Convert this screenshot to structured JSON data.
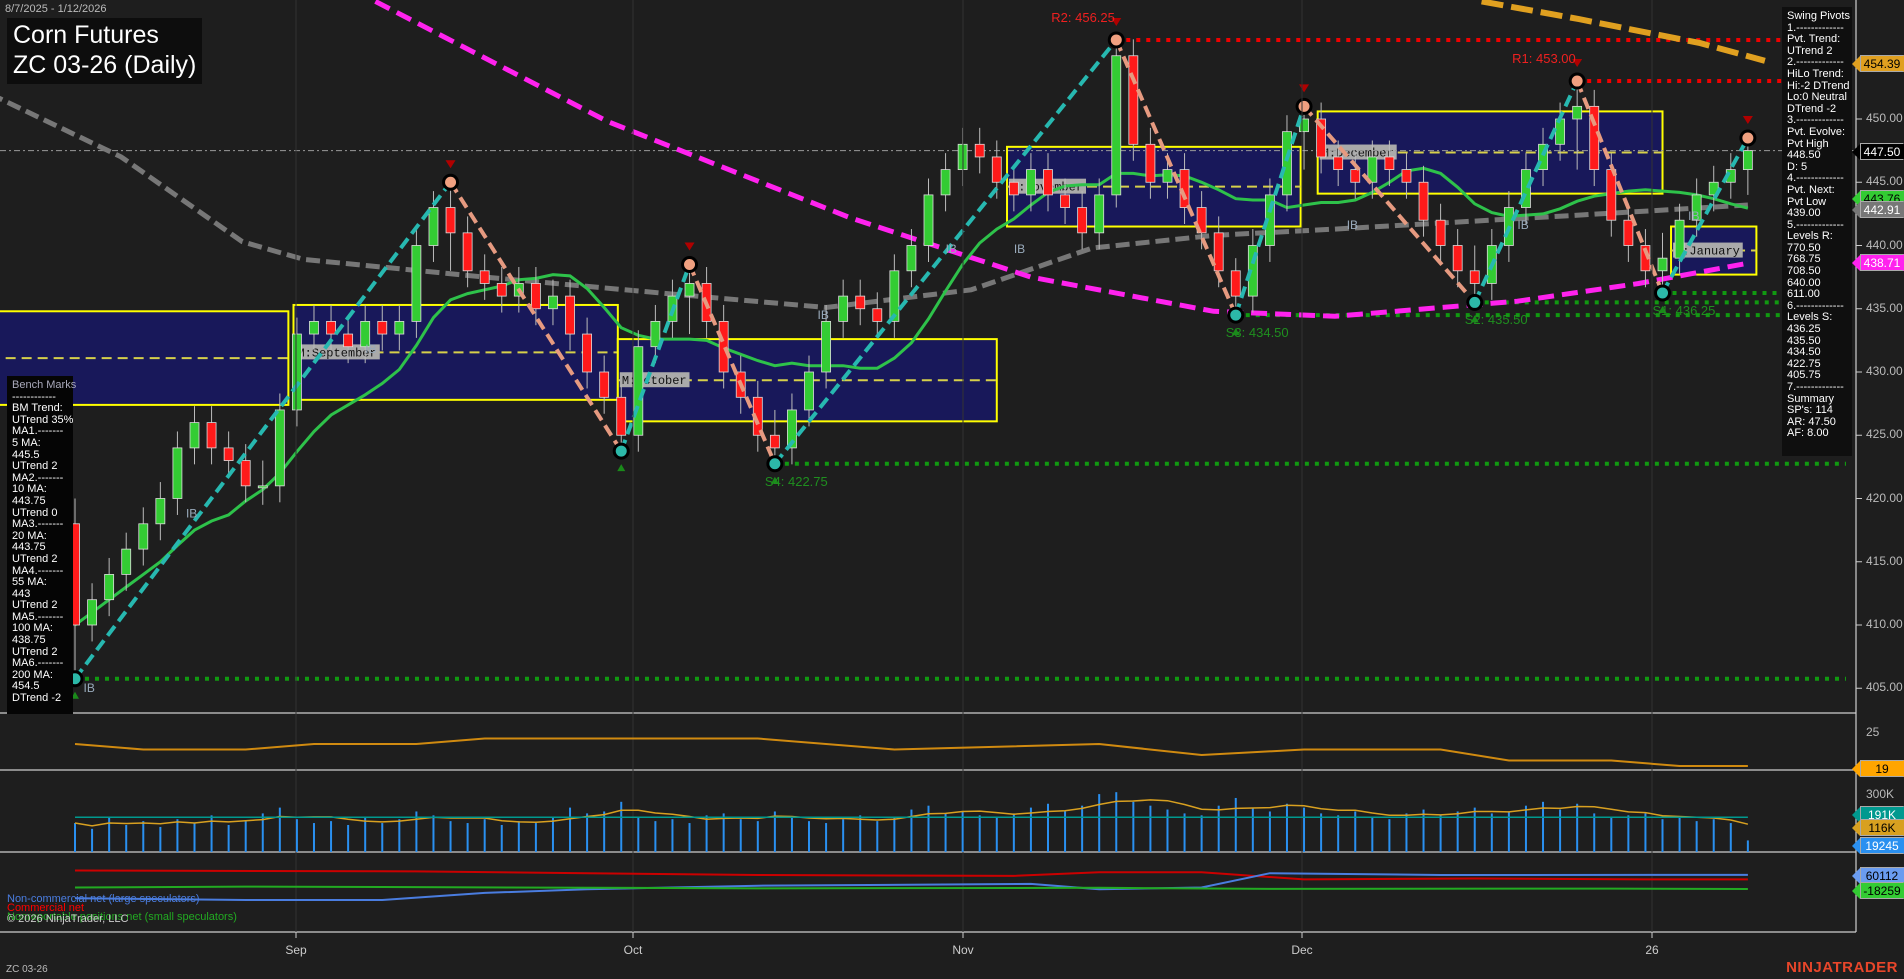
{
  "header": {
    "date_range": "8/7/2025 - 1/12/2026",
    "title_line1": "Corn Futures",
    "title_line2": "ZC 03-26 (Daily)"
  },
  "colors": {
    "background": "#1e1e1e",
    "up": "#33cc33",
    "down": "#ff1a1a",
    "box_fill": "#18185a",
    "box_border": "#ffff00",
    "ma_green": "#2ec24a",
    "ma_gray": "#777777",
    "ma_magenta": "#ff22ee",
    "ma_orange": "#e0a020",
    "pivot_up": "#27b8b0",
    "pivot_down": "#e69a80",
    "resistance": "#ee0000",
    "support": "#119911"
  },
  "swing_pivots_panel": {
    "lines": [
      "Swing Pivots",
      "1.-------------",
      "Pvt. Trend:",
      "UTrend 2",
      "2.-------------",
      "HiLo Trend:",
      "Hi:-2 DTrend",
      "Lo:0 Neutral",
      "DTrend -2",
      "3.-------------",
      "Pvt. Evolve:",
      "Pvt High",
      "448.50",
      "D: 5",
      "4.-------------",
      "Pvt. Next:",
      "Pvt Low",
      "439.00",
      "5.-------------",
      "Levels R:",
      "770.50",
      "768.75",
      "708.50",
      "640.00",
      "611.00",
      "6.-------------",
      "Levels S:",
      "436.25",
      "435.50",
      "434.50",
      "422.75",
      "405.75",
      "7.-------------",
      "Summary",
      "SP's: 114",
      "AR: 47.50",
      "AF: 8.00"
    ]
  },
  "benchmarks_panel": {
    "lines": [
      "Bench Marks",
      "------------",
      "BM Trend:",
      "UTrend 35%",
      "MA1.-------",
      "5 MA:",
      "445.5",
      "UTrend 2",
      "MA2.-------",
      "10 MA:",
      "443.75",
      "UTrend 0",
      "MA3.-------",
      "20 MA:",
      "443.75",
      "UTrend 2",
      "MA4.-------",
      "55 MA:",
      "443",
      "UTrend 2",
      "MA5.-------",
      "100 MA:",
      "438.75",
      "UTrend 2",
      "MA6.-------",
      "200 MA:",
      "454.5",
      "DTrend -2"
    ]
  },
  "price_axis": {
    "ticks": [
      "450.00",
      "445.00",
      "440.00",
      "435.00",
      "430.00",
      "425.00",
      "420.00",
      "415.00",
      "410.00",
      "405.00"
    ],
    "tick_values": [
      450,
      445,
      440,
      435,
      430,
      425,
      420,
      415,
      410,
      405
    ]
  },
  "axis_tags": [
    {
      "label": "454.39",
      "value": 454.39,
      "bg": "#e0a020",
      "fg": "#000"
    },
    {
      "label": "447.50",
      "value": 447.5,
      "bg": "#000000",
      "fg": "#fff"
    },
    {
      "label": "443.76",
      "value": 443.76,
      "bg": "#33cc33",
      "fg": "#000"
    },
    {
      "label": "442.91",
      "value": 442.91,
      "bg": "#777777",
      "fg": "#fff"
    },
    {
      "label": "438.71",
      "value": 438.71,
      "bg": "#ff22ee",
      "fg": "#fff"
    }
  ],
  "levels": [
    {
      "label": "R2: 456.25",
      "price": 456.25,
      "from": 61,
      "kind": "resistance"
    },
    {
      "label": "R1: 453.00",
      "price": 453.0,
      "from": 88,
      "kind": "resistance"
    },
    {
      "label": "S1: 436.25",
      "price": 436.25,
      "from": 93,
      "kind": "support"
    },
    {
      "label": "S2: 435.50",
      "price": 435.5,
      "from": 82,
      "kind": "support"
    },
    {
      "label": "S3: 434.50",
      "price": 434.5,
      "from": 68,
      "kind": "support"
    },
    {
      "label": "S4: 422.75",
      "price": 422.75,
      "from": 41,
      "kind": "support"
    },
    {
      "label": "",
      "price": 405.75,
      "from": 0,
      "kind": "support"
    }
  ],
  "value_boxes": [
    {
      "label": "",
      "from": -5,
      "to": 12.5,
      "high": 434.8,
      "low": 427.4
    },
    {
      "label": "M:September",
      "from": 12.8,
      "to": 31.8,
      "high": 435.3,
      "low": 427.8
    },
    {
      "label": "M:October",
      "from": 31.8,
      "to": 54,
      "high": 432.6,
      "low": 426.1
    },
    {
      "label": "M:November",
      "from": 54.6,
      "to": 71.8,
      "high": 447.8,
      "low": 441.5
    },
    {
      "label": "M:December",
      "from": 72.8,
      "to": 93,
      "high": 450.6,
      "low": 444.1
    },
    {
      "label": "M:January",
      "from": 93.5,
      "to": 98.5,
      "high": 441.5,
      "low": 437.7
    }
  ],
  "ib_labels": [
    {
      "label": "IB",
      "i": 0.5,
      "p": 404.7
    },
    {
      "label": "IB",
      "i": 6.5,
      "p": 418.5
    },
    {
      "label": "IB",
      "i": 17,
      "p": 431.5
    },
    {
      "label": "IB",
      "i": 43.5,
      "p": 434.2
    },
    {
      "label": "IB",
      "i": 51,
      "p": 439.4
    },
    {
      "label": "IB",
      "i": 55,
      "p": 439.4
    },
    {
      "label": "IB",
      "i": 74.5,
      "p": 441.3
    },
    {
      "label": "IB",
      "i": 84.5,
      "p": 441.3
    },
    {
      "label": "IB",
      "i": 94.5,
      "p": 442
    }
  ],
  "month_labels": [
    "Sep",
    "Oct",
    "Nov",
    "Dec",
    "26"
  ],
  "indicator_panel": {
    "ticks": [
      "25"
    ],
    "tag": "19"
  },
  "volume_panel": {
    "ticks": [
      "300K"
    ],
    "tags": [
      {
        "label": "191K",
        "bg": "#00998f",
        "fg": "#fff"
      },
      {
        "label": "116K",
        "bg": "#d8a020",
        "fg": "#000"
      },
      {
        "label": "19245",
        "bg": "#2a90f0",
        "fg": "#fff"
      }
    ]
  },
  "cot_panel": {
    "legend": [
      {
        "label": "Non-commercial net (large speculators)",
        "color": "#4a7de0"
      },
      {
        "label": "Commercial net",
        "color": "#ff0000"
      },
      {
        "label": "Nonreportable positions net (small speculators)",
        "color": "#22aa22"
      }
    ],
    "tags": [
      {
        "label": "60112",
        "bg": "#6a9cf0",
        "fg": "#000"
      },
      {
        "label": "-18259",
        "bg": "#33cc33",
        "fg": "#000"
      }
    ]
  },
  "copyright": "© 2026 NinjaTrader, LLC",
  "footer_symbol": "ZC 03-26",
  "logo": "NINJATRADER",
  "chart_data": {
    "type": "candlestick",
    "symbol": "ZC 03-26",
    "interval": "Daily",
    "ylim": [
      402,
      459
    ],
    "closes": [
      410,
      412,
      414,
      416,
      418,
      420,
      424,
      426,
      424,
      423,
      421,
      421,
      427,
      433,
      434,
      433,
      432,
      434,
      433,
      434,
      440,
      443,
      441,
      438,
      437,
      436,
      437,
      435,
      436,
      433,
      430,
      428,
      425,
      432,
      434,
      436,
      437,
      434,
      430,
      428,
      425,
      424,
      427,
      430,
      434,
      436,
      435,
      434,
      438,
      440,
      444,
      446,
      448,
      447,
      445,
      444,
      446,
      444,
      443,
      441,
      444,
      455,
      448,
      445,
      446,
      443,
      441,
      438,
      436,
      440,
      444,
      449,
      450,
      447,
      446,
      445,
      447,
      446,
      445,
      442,
      440,
      438,
      437,
      440,
      443,
      446,
      448,
      450,
      451,
      446,
      442,
      440,
      438,
      439,
      442,
      444,
      445,
      446,
      447.5
    ],
    "extremes": {
      "0": [
        420,
        405.75
      ],
      "11": [
        423,
        419.5
      ],
      "22": [
        445,
        438
      ],
      "32": [
        429,
        423.75
      ],
      "36": [
        438.5,
        433
      ],
      "41": [
        427,
        422.75
      ],
      "61": [
        456.25,
        443
      ],
      "68": [
        439,
        434.5
      ],
      "72": [
        451,
        446
      ],
      "82": [
        440,
        435.5
      ],
      "88": [
        453,
        446
      ],
      "93": [
        441,
        436.25
      ],
      "98": [
        448.5,
        444
      ]
    },
    "pivots": [
      [
        0,
        405.75
      ],
      [
        22,
        445
      ],
      [
        32,
        423.75
      ],
      [
        36,
        438.5
      ],
      [
        41,
        422.75
      ],
      [
        61,
        456.25
      ],
      [
        68,
        434.5
      ],
      [
        72,
        451
      ],
      [
        82,
        435.5
      ],
      [
        88,
        453
      ],
      [
        93,
        436.25
      ],
      [
        98,
        448.5
      ]
    ],
    "ma_gray": [
      [
        -5,
        452
      ],
      [
        2.7,
        447
      ],
      [
        9.8,
        440.3
      ],
      [
        13.4,
        438.9
      ],
      [
        24,
        437.5
      ],
      [
        34.7,
        436.2
      ],
      [
        44,
        435.1
      ],
      [
        52.5,
        436.5
      ],
      [
        59.6,
        439.8
      ],
      [
        66.7,
        440.8
      ],
      [
        73.8,
        441.3
      ],
      [
        88.1,
        442.4
      ],
      [
        98,
        443.2
      ]
    ],
    "ma_magenta": [
      [
        17.6,
        459.3
      ],
      [
        31.2,
        449.8
      ],
      [
        45.4,
        442.2
      ],
      [
        56,
        437.5
      ],
      [
        66.7,
        434.8
      ],
      [
        73.8,
        434.4
      ],
      [
        84.5,
        435.6
      ],
      [
        91.6,
        437
      ],
      [
        98,
        438.6
      ]
    ],
    "ma_orange": [
      [
        82.4,
        459.3
      ],
      [
        88.1,
        457.9
      ],
      [
        95.2,
        456
      ],
      [
        99,
        454.6
      ]
    ],
    "last_price": 447.5,
    "indicator": [
      [
        0,
        23
      ],
      [
        4,
        22
      ],
      [
        10,
        22
      ],
      [
        14,
        23
      ],
      [
        20,
        23
      ],
      [
        24,
        24
      ],
      [
        40,
        24
      ],
      [
        48,
        22
      ],
      [
        60,
        23
      ],
      [
        66,
        21
      ],
      [
        72,
        22
      ],
      [
        80,
        22
      ],
      [
        84,
        20
      ],
      [
        90,
        20
      ],
      [
        94,
        19
      ],
      [
        98,
        19
      ]
    ],
    "volume_k": [
      150,
      120,
      180,
      140,
      160,
      130,
      170,
      150,
      190,
      140,
      160,
      200,
      230,
      170,
      150,
      160,
      140,
      180,
      150,
      170,
      210,
      190,
      160,
      150,
      170,
      140,
      160,
      150,
      180,
      230,
      200,
      210,
      260,
      180,
      160,
      170,
      150,
      190,
      200,
      170,
      160,
      210,
      180,
      160,
      150,
      170,
      190,
      160,
      180,
      220,
      240,
      200,
      210,
      190,
      180,
      200,
      230,
      250,
      210,
      240,
      300,
      310,
      260,
      240,
      220,
      200,
      190,
      240,
      280,
      230,
      210,
      250,
      230,
      200,
      190,
      210,
      180,
      170,
      200,
      220,
      190,
      210,
      230,
      200,
      210,
      240,
      260,
      220,
      250,
      200,
      180,
      190,
      200,
      170,
      180,
      160,
      170,
      150,
      60
    ],
    "cot_noncommercial": [
      [
        0,
        -70000
      ],
      [
        10,
        -80000
      ],
      [
        18,
        -80000
      ],
      [
        24,
        -40000
      ],
      [
        30,
        -20000
      ],
      [
        40,
        0
      ],
      [
        56,
        10000
      ],
      [
        60,
        -20000
      ],
      [
        66,
        -10000
      ],
      [
        70,
        70000
      ],
      [
        80,
        60000
      ],
      [
        98,
        60112
      ]
    ],
    "cot_commercial": [
      [
        0,
        85000
      ],
      [
        20,
        80000
      ],
      [
        30,
        70000
      ],
      [
        40,
        60000
      ],
      [
        55,
        55000
      ],
      [
        60,
        75000
      ],
      [
        66,
        75000
      ],
      [
        72,
        35000
      ],
      [
        82,
        40000
      ],
      [
        92,
        35000
      ],
      [
        98,
        35000
      ]
    ],
    "cot_nonreportable": [
      [
        0,
        -10000
      ],
      [
        10,
        -5000
      ],
      [
        20,
        -8000
      ],
      [
        40,
        -15000
      ],
      [
        60,
        -12000
      ],
      [
        70,
        -18000
      ],
      [
        90,
        -16000
      ],
      [
        98,
        -18259
      ]
    ]
  }
}
